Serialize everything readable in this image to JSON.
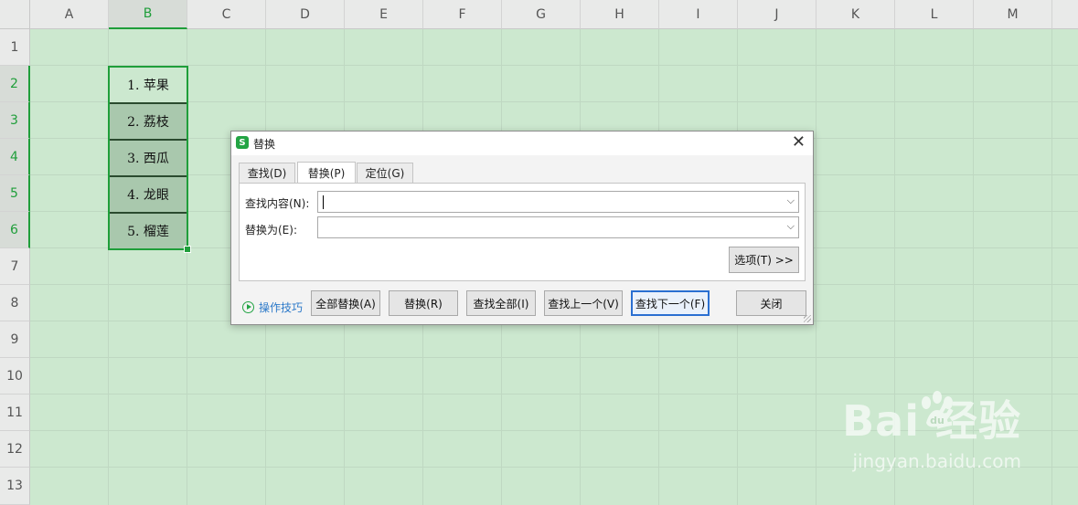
{
  "columns": [
    "A",
    "B",
    "C",
    "D",
    "E",
    "F",
    "G",
    "H",
    "I",
    "J",
    "K",
    "L",
    "M"
  ],
  "selected_column": "B",
  "rows": [
    "1",
    "2",
    "3",
    "4",
    "5",
    "6",
    "7",
    "8",
    "9",
    "10",
    "11",
    "12",
    "13"
  ],
  "selected_rows": [
    "2",
    "3",
    "4",
    "5",
    "6"
  ],
  "cells": [
    {
      "ref": "B2",
      "value": "1. 苹果",
      "active": true
    },
    {
      "ref": "B3",
      "value": "2. 荔枝",
      "active": false
    },
    {
      "ref": "B4",
      "value": "3. 西瓜",
      "active": false
    },
    {
      "ref": "B5",
      "value": "4. 龙眼",
      "active": false
    },
    {
      "ref": "B6",
      "value": "5. 榴莲",
      "active": false
    }
  ],
  "dialog": {
    "icon_letter": "S",
    "title": "替换",
    "close_glyph": "✕",
    "tabs": [
      {
        "label": "查找(D)",
        "active": false
      },
      {
        "label": "替换(P)",
        "active": true
      },
      {
        "label": "定位(G)",
        "active": false
      }
    ],
    "find_label": "查找内容(N):",
    "find_value": "",
    "replace_label": "替换为(E):",
    "replace_value": "",
    "dropdown_glyph": "⌵",
    "options_button": "选项(T) >>",
    "tips_link": "操作技巧",
    "buttons": {
      "replace_all": "全部替换(A)",
      "replace": "替换(R)",
      "find_all": "查找全部(I)",
      "find_prev": "查找上一个(V)",
      "find_next": "查找下一个(F)",
      "close": "关闭"
    }
  },
  "watermark": {
    "main": "Bai  经验",
    "sub": "jingyan.baidu.com"
  },
  "colors": {
    "sheet_background": "#cce8cf",
    "selection_accent": "#1f9e3a",
    "focus_button_border": "#2a6fd1",
    "tips_link": "#2c79c9"
  }
}
